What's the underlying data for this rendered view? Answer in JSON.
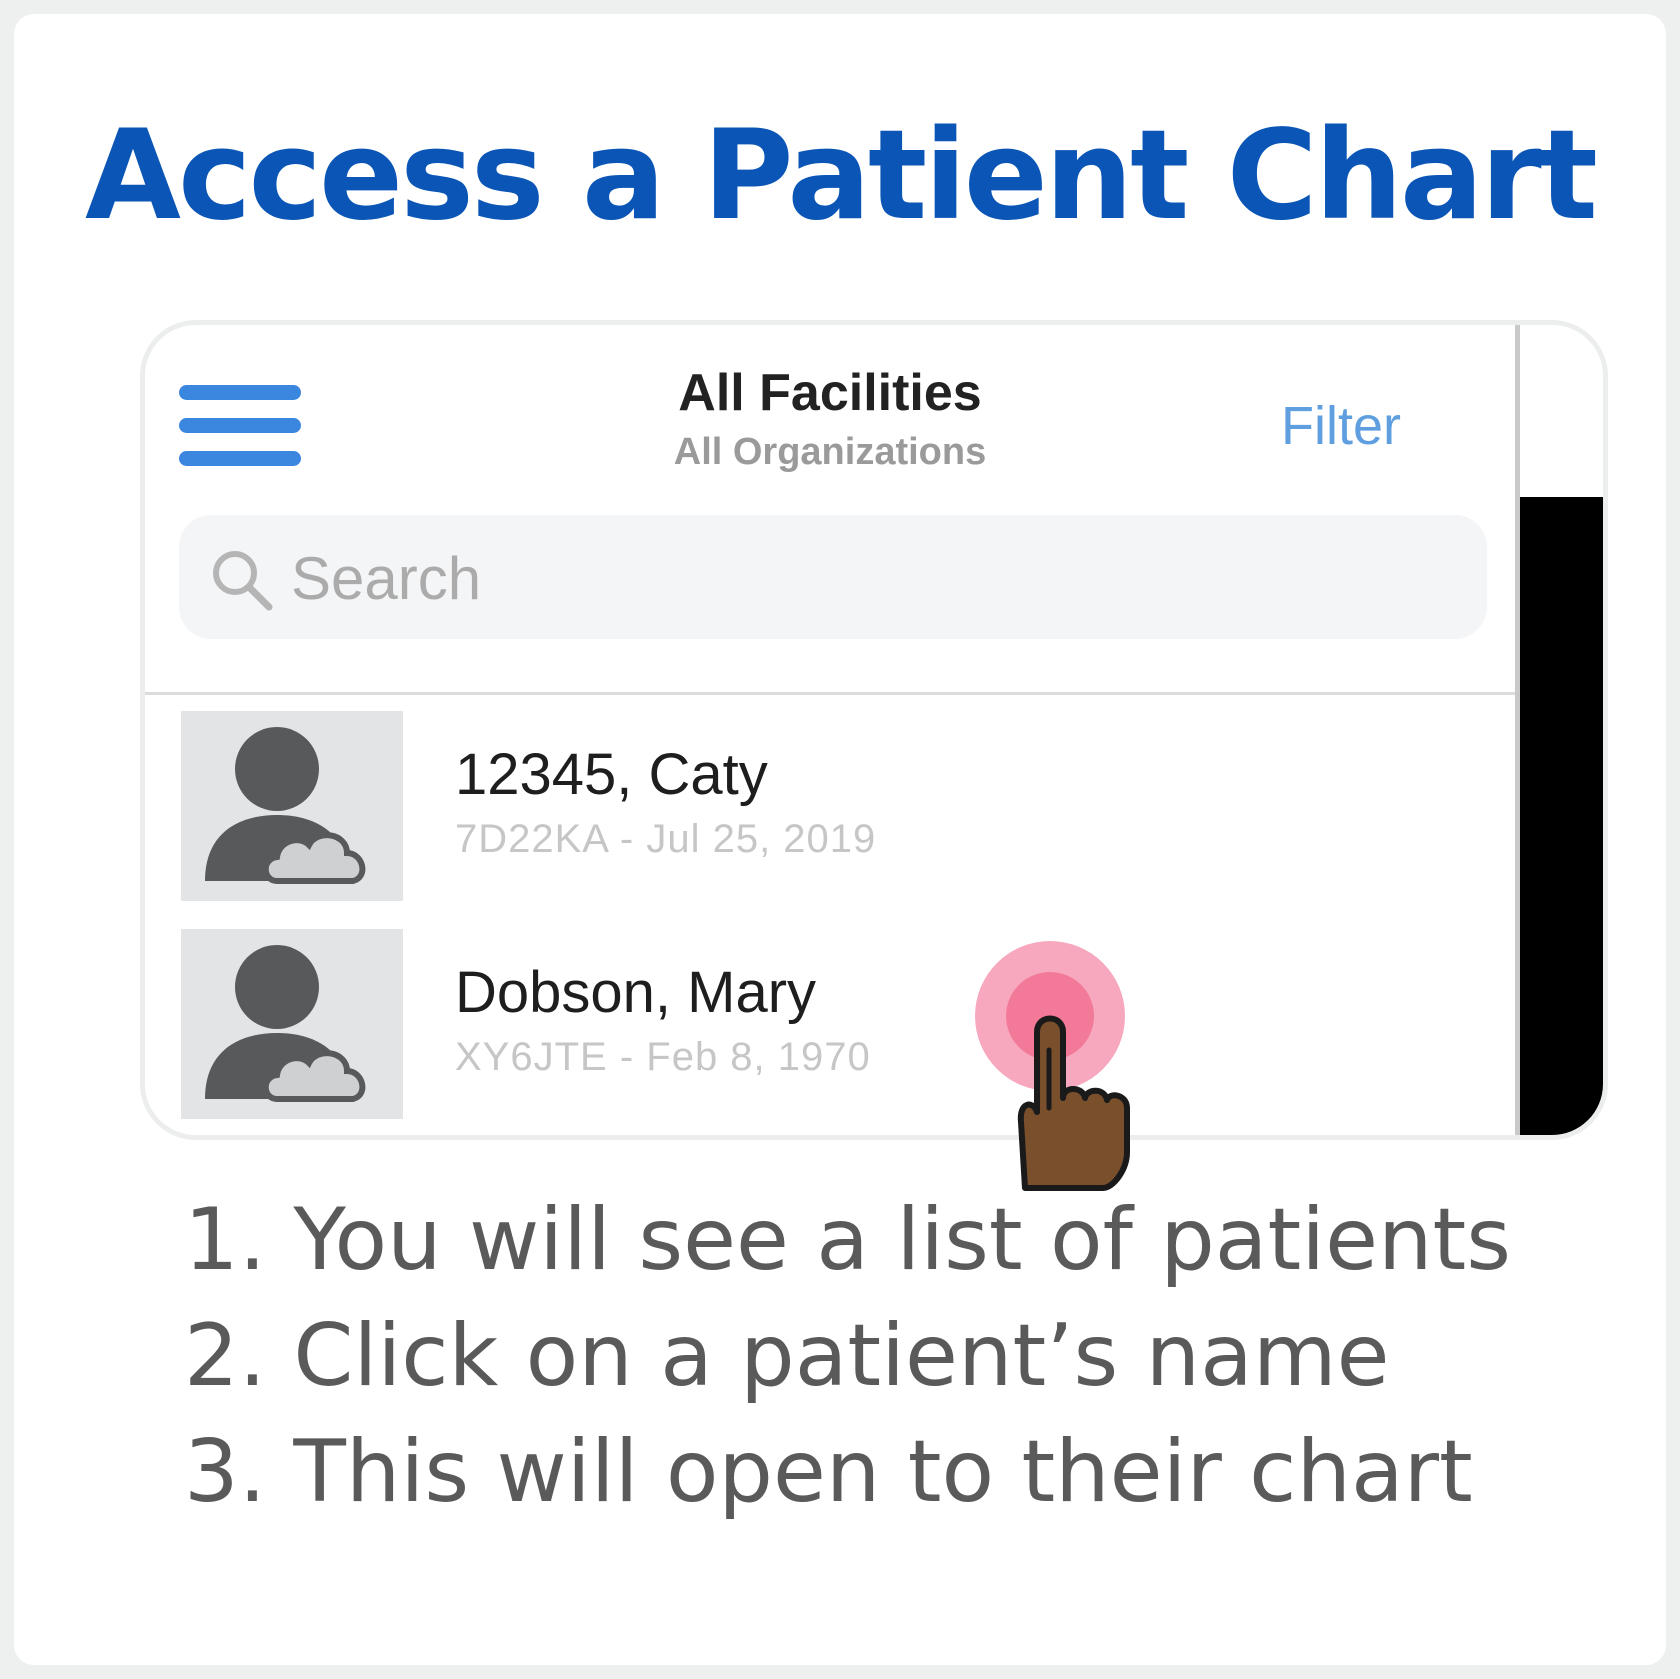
{
  "heading": "Access a Patient Chart",
  "app": {
    "header_title": "All Facilities",
    "header_subtitle": "All Organizations",
    "filter_label": "Filter",
    "search": {
      "placeholder": "Search",
      "value": ""
    },
    "patients": [
      {
        "name": "12345, Caty",
        "meta": "7D22KA - Jul 25, 2019"
      },
      {
        "name": "Dobson, Mary",
        "meta": "XY6JTE - Feb 8, 1970"
      }
    ]
  },
  "steps": [
    "1. You will see a list of patients",
    "2. Click on a patient’s name",
    "3. This will open to their chart"
  ],
  "colors": {
    "heading": "#0a55b5",
    "menu_icon": "#3b87e0",
    "filter": "#5f9fe0",
    "tap_outer": "#f7a8be",
    "tap_inner": "#f27a98",
    "hand": "#7a4f2c"
  },
  "icons": [
    "hamburger-menu-icon",
    "search-icon",
    "patient-avatar-icon",
    "tap-indicator-icon",
    "pointing-hand-icon"
  ]
}
